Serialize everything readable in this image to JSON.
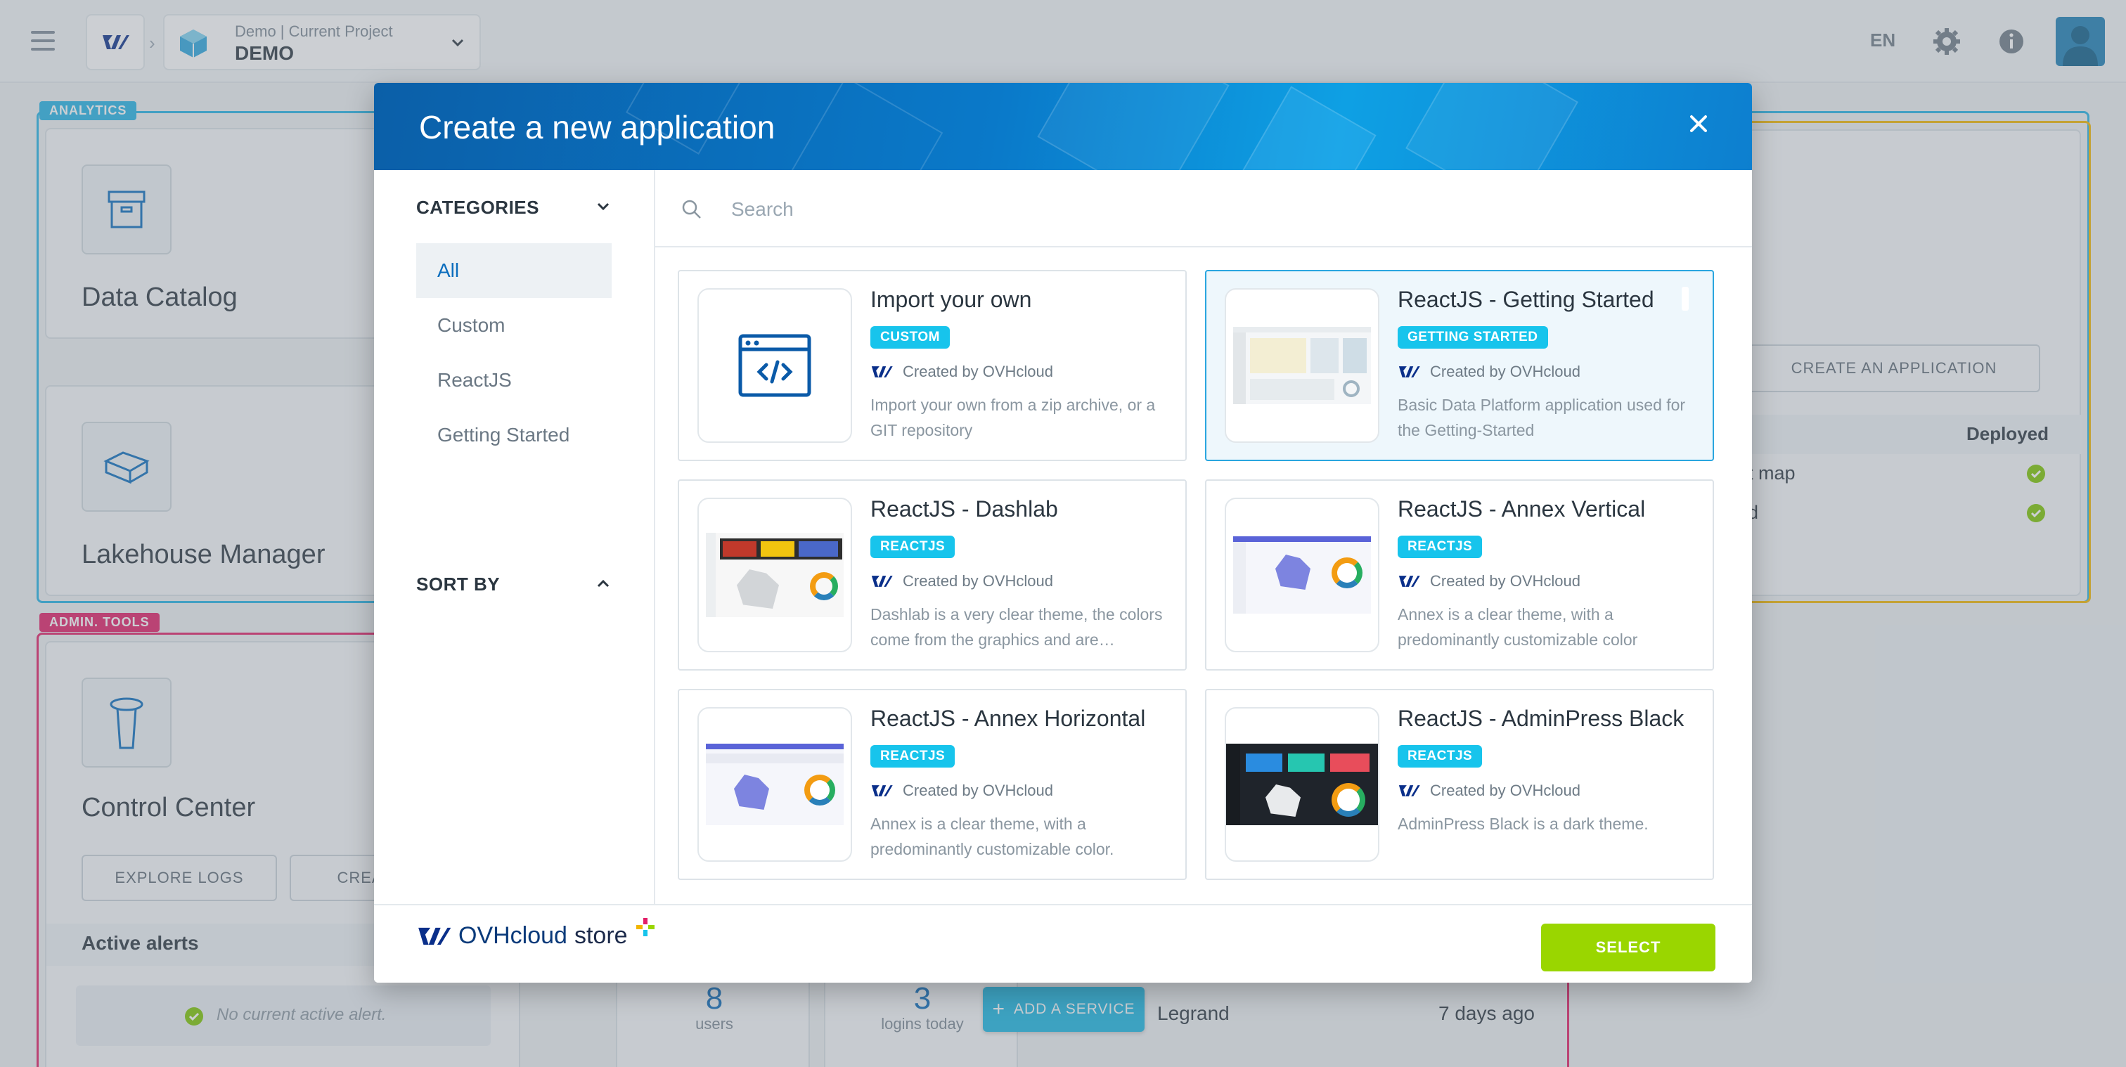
{
  "topbar": {
    "project_sub": "Demo | Current Project",
    "project_name": "DEMO",
    "lang": "EN"
  },
  "background": {
    "analytics_tag": "ANALYTICS",
    "admin_tag": "ADMIN. TOOLS",
    "data_catalog": "Data Catalog",
    "lakehouse_manager": "Lakehouse Manager",
    "control_center": "Control Center",
    "explore_logs": "EXPLORE LOGS",
    "create_partial": "CREA",
    "active_alerts": "Active alerts",
    "no_alert": "No current active alert.",
    "users_count": "8",
    "users_label": "users",
    "logins_count": "3",
    "logins_label": "logins today",
    "legrand": "Legrand",
    "days_ago": "7 days ago",
    "create_application": "CREATE AN APPLICATION",
    "deployed": "Deployed",
    "row1": "t map",
    "row2": "d",
    "add_service": "ADD A SERVICE"
  },
  "modal": {
    "title": "Create a new application",
    "categories_label": "CATEGORIES",
    "sort_by_label": "SORT BY",
    "categories": [
      "All",
      "Custom",
      "ReactJS",
      "Getting Started"
    ],
    "search_placeholder": "Search",
    "select_label": "SELECT",
    "store_brand": "OVHcloud",
    "store_suffix": "store"
  },
  "apps": [
    {
      "title": "Import your own",
      "badge": "CUSTOM",
      "creator": "Created by OVHcloud",
      "desc": "Import your own from a zip archive, or a GIT repository"
    },
    {
      "title": "ReactJS - Getting Started",
      "badge": "GETTING STARTED",
      "creator": "Created by OVHcloud",
      "desc": "Basic Data Platform application used for the Getting-Started"
    },
    {
      "title": "ReactJS - Dashlab",
      "badge": "REACTJS",
      "creator": "Created by OVHcloud",
      "desc": "Dashlab is a very clear theme, the colors come from the graphics and are…"
    },
    {
      "title": "ReactJS - Annex Vertical",
      "badge": "REACTJS",
      "creator": "Created by OVHcloud",
      "desc": "Annex is a clear theme, with a predominantly customizable color"
    },
    {
      "title": "ReactJS - Annex Horizontal",
      "badge": "REACTJS",
      "creator": "Created by OVHcloud",
      "desc": "Annex is a clear theme, with a predominantly customizable color."
    },
    {
      "title": "ReactJS - AdminPress Black",
      "badge": "REACTJS",
      "creator": "Created by OVHcloud",
      "desc": "AdminPress Black is a dark theme."
    }
  ],
  "colors": {
    "accent": "#0a6dbd",
    "badge": "#17c4ec",
    "select": "#9ad600",
    "analytics": "#22b4e6",
    "admin": "#e21d67",
    "third": "#f2b600"
  },
  "icons": [
    "menu-icon",
    "ovh-logo-icon",
    "project-cube-icon",
    "chevron-down-icon",
    "gear-icon",
    "info-icon",
    "user-avatar-icon",
    "close-icon",
    "search-icon",
    "code-window-icon",
    "check-icon"
  ]
}
